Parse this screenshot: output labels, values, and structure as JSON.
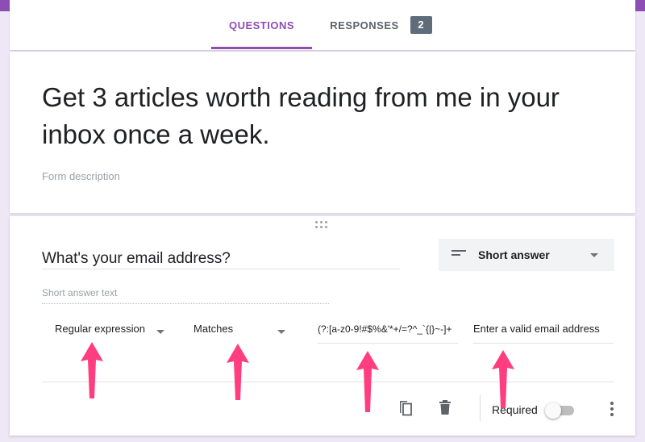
{
  "tabs": {
    "questions_label": "QUESTIONS",
    "responses_label": "RESPONSES",
    "responses_count": "2"
  },
  "form": {
    "title": "Get 3 articles worth reading from me in your inbox once a week.",
    "description_placeholder": "Form description"
  },
  "question": {
    "title": "What's your email address?",
    "type_label": "Short answer",
    "type_icon": "short-text-icon",
    "answer_placeholder": "Short answer text",
    "validation": {
      "type": "Regular expression",
      "condition": "Matches",
      "pattern": "(?:[a-z0-9!#$%&'*+/=?^_`{|}~-]+",
      "error_text": "Enter a valid email address"
    },
    "required_label": "Required",
    "required": false
  },
  "icons": {
    "duplicate": "duplicate-icon",
    "delete": "trash-icon",
    "more": "more-vert-icon",
    "drag": "drag-handle-icon"
  },
  "colors": {
    "accent": "#8e4cb5",
    "annotation_arrow": "#ff3d7f",
    "badge": "#5f6d7b",
    "background": "#ede7f6"
  }
}
